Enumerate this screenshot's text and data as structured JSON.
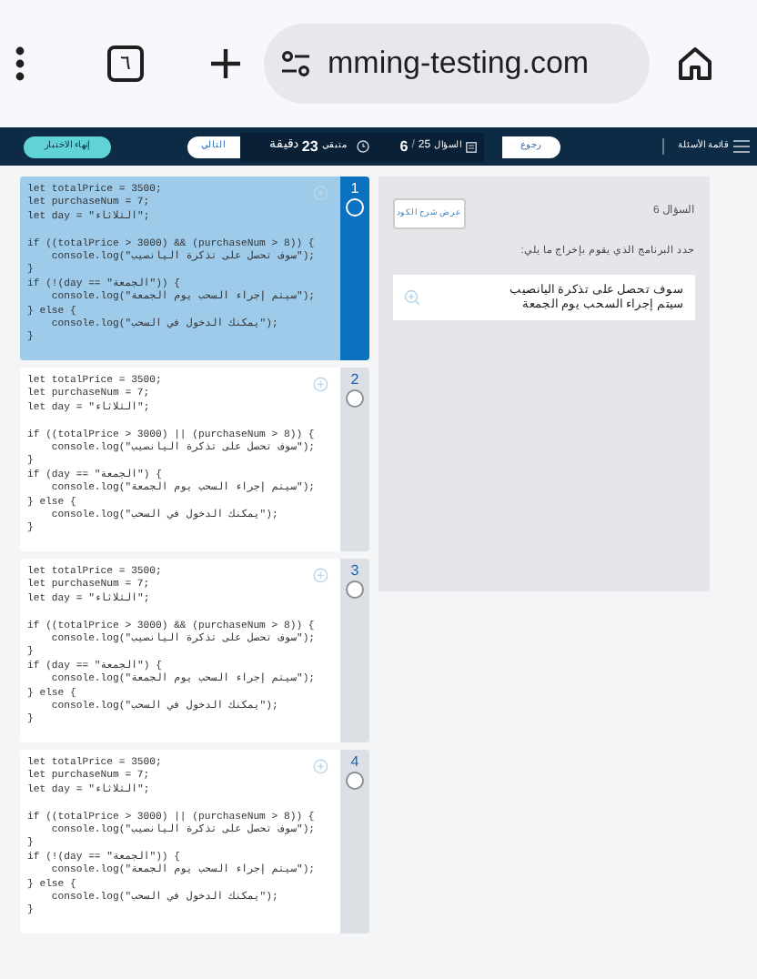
{
  "browser": {
    "tab_count": "٦",
    "url": "mming-testing.com"
  },
  "header": {
    "menu_label": "قائمة الأسئلة",
    "back_button": "رجوع",
    "question_label": "السؤال",
    "question_total": "25",
    "question_separator": "/",
    "question_current": "6",
    "time_label": "متبقي",
    "time_value": "23",
    "time_unit": "دقيقة",
    "next_button": "التالي",
    "finish_button": "إنهاء الاختبار"
  },
  "options": [
    {
      "number": "1",
      "selected": true,
      "code": "let totalPrice = 3500;\nlet purchaseNum = 7;\nlet day = \"الثلاثاء\";\n\nif ((totalPrice > 3000) && (purchaseNum > 8)) {\n    console.log(\"سوف تحصل على تذكرة اليانصيب\");\n}\nif (!(day == \"الجمعة\")) {\n    console.log(\"سيتم إجراء السحب يوم الجمعة\");\n} else {\n    console.log(\"يمكنك الدخول في السحب\");\n}"
    },
    {
      "number": "2",
      "selected": false,
      "code": "let totalPrice = 3500;\nlet purchaseNum = 7;\nlet day = \"الثلاثاء\";\n\nif ((totalPrice > 3000) || (purchaseNum > 8)) {\n    console.log(\"سوف تحصل على تذكرة اليانصيب\");\n}\nif (day == \"الجمعة\") {\n    console.log(\"سيتم إجراء السحب يوم الجمعة\");\n} else {\n    console.log(\"يمكنك الدخول في السحب\");\n}"
    },
    {
      "number": "3",
      "selected": false,
      "code": "let totalPrice = 3500;\nlet purchaseNum = 7;\nlet day = \"الثلاثاء\";\n\nif ((totalPrice > 3000) && (purchaseNum > 8)) {\n    console.log(\"سوف تحصل على تذكرة اليانصيب\");\n}\nif (day == \"الجمعة\") {\n    console.log(\"سيتم إجراء السحب يوم الجمعة\");\n} else {\n    console.log(\"يمكنك الدخول في السحب\");\n}"
    },
    {
      "number": "4",
      "selected": false,
      "code": "let totalPrice = 3500;\nlet purchaseNum = 7;\nlet day = \"الثلاثاء\";\n\nif ((totalPrice > 3000) || (purchaseNum > 8)) {\n    console.log(\"سوف تحصل على تذكرة اليانصيب\");\n}\nif (!(day == \"الجمعة\")) {\n    console.log(\"سيتم إجراء السحب يوم الجمعة\");\n} else {\n    console.log(\"يمكنك الدخول في السحب\");\n}"
    }
  ],
  "question": {
    "title": "السؤال 6",
    "explain_button": "عرض شرح الكود",
    "prompt": "حدد البرنامج الذي يقوم بإخراج ما يلي:",
    "output_lines": [
      "سوف تحصل على تذكرة اليانصيب",
      "سيتم إجراء السحب يوم الجمعة"
    ]
  }
}
